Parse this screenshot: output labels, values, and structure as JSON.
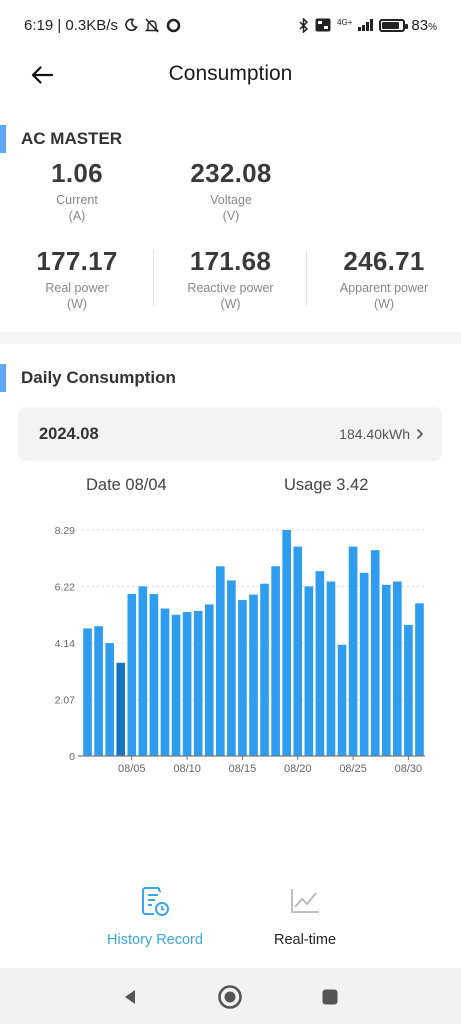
{
  "status_bar": {
    "time_speed": "6:19 | 0.3KB/s",
    "network_label": "4G+",
    "battery_percent": "83",
    "battery_level": 0.83
  },
  "header": {
    "title": "Consumption"
  },
  "device": {
    "name": "AC MASTER",
    "metrics": [
      {
        "value": "1.06",
        "label": "Current",
        "unit": "(A)"
      },
      {
        "value": "232.08",
        "label": "Voltage",
        "unit": "(V)"
      },
      {
        "value": "177.17",
        "label": "Real power",
        "unit": "(W)"
      },
      {
        "value": "171.68",
        "label": "Reactive power",
        "unit": "(W)"
      },
      {
        "value": "246.71",
        "label": "Apparent power",
        "unit": "(W)"
      }
    ]
  },
  "daily": {
    "section_title": "Daily Consumption",
    "month": "2024.08",
    "month_total": "184.40kWh",
    "selected_date": "Date 08/04",
    "selected_usage": "Usage 3.42"
  },
  "chart_data": {
    "type": "bar",
    "categories": [
      "08/01",
      "08/02",
      "08/03",
      "08/04",
      "08/05",
      "08/06",
      "08/07",
      "08/08",
      "08/09",
      "08/10",
      "08/11",
      "08/12",
      "08/13",
      "08/14",
      "08/15",
      "08/16",
      "08/17",
      "08/18",
      "08/19",
      "08/20",
      "08/21",
      "08/22",
      "08/23",
      "08/24",
      "08/25",
      "08/26",
      "08/27",
      "08/28",
      "08/29",
      "08/30",
      "08/31"
    ],
    "values": [
      4.68,
      4.76,
      4.14,
      3.42,
      5.94,
      6.22,
      5.94,
      5.41,
      5.18,
      5.28,
      5.32,
      5.56,
      6.96,
      6.44,
      5.72,
      5.92,
      6.32,
      6.96,
      8.29,
      7.68,
      6.22,
      6.78,
      6.4,
      4.08,
      7.68,
      6.72,
      7.55,
      6.28,
      6.4,
      4.81,
      5.6
    ],
    "selected_index": 3,
    "y_ticks": [
      "8.29",
      "6.22",
      "4.14",
      "2.07",
      "0"
    ],
    "y_tick_values": [
      8.29,
      6.22,
      4.14,
      2.07,
      0
    ],
    "ylim": [
      0,
      8.29
    ],
    "x_tick_labels": [
      "08/05",
      "08/10",
      "08/15",
      "08/20",
      "08/25",
      "08/30"
    ],
    "x_tick_indices": [
      4,
      9,
      14,
      19,
      24,
      29
    ],
    "grid": true,
    "colors": {
      "bar": "#2e9cef",
      "bar_selected": "#1574c4",
      "grid": "#d8d8d8",
      "axis": "#777777"
    }
  },
  "tabs": [
    {
      "label": "History Record",
      "icon": "history-record-icon",
      "active": true
    },
    {
      "label": "Real-time",
      "icon": "line-chart-icon",
      "active": false
    }
  ],
  "colors": {
    "accent": "#5fa8f5",
    "tab_active": "#3aa6ea",
    "tab_inactive": "#222222"
  }
}
